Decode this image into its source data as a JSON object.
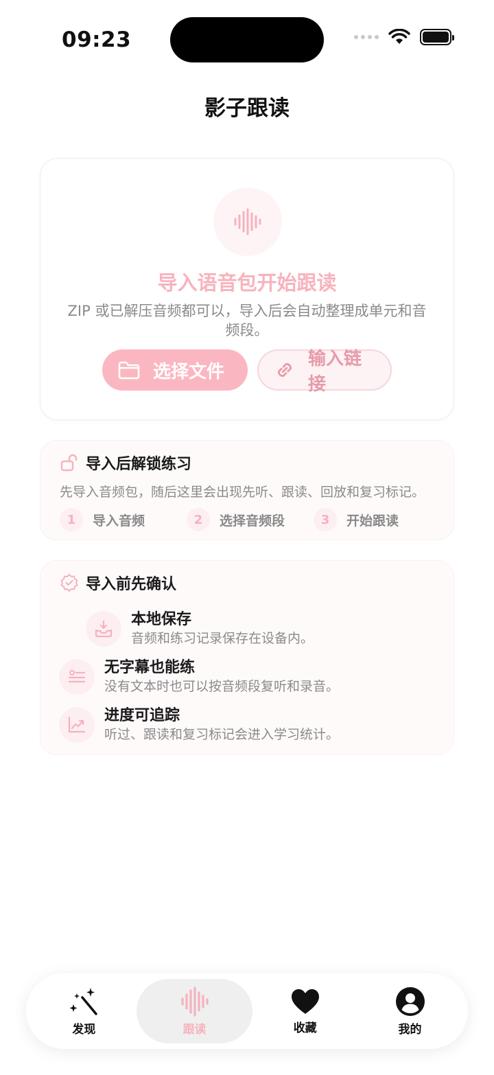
{
  "status": {
    "time": "09:23"
  },
  "page": {
    "title": "影子跟读"
  },
  "import_card": {
    "title": "导入语音包开始跟读",
    "description": "ZIP 或已解压音频都可以，导入后会自动整理成单元和音频段。",
    "primary_button": "选择文件",
    "secondary_button": "输入链接"
  },
  "unlock_card": {
    "title": "导入后解锁练习",
    "description": "先导入音频包，随后这里会出现先听、跟读、回放和复习标记。",
    "steps": [
      {
        "num": "1",
        "label": "导入音频"
      },
      {
        "num": "2",
        "label": "选择音频段"
      },
      {
        "num": "3",
        "label": "开始跟读"
      }
    ]
  },
  "confirm_card": {
    "title": "导入前先确认",
    "features": [
      {
        "title": "本地保存",
        "sub": "音频和练习记录保存在设备内。",
        "icon": "tray-download-icon"
      },
      {
        "title": "无字幕也能练",
        "sub": "没有文本时也可以按音频段复听和录音。",
        "icon": "list-icon"
      },
      {
        "title": "进度可追踪",
        "sub": "听过、跟读和复习标记会进入学习统计。",
        "icon": "chart-trend-icon"
      }
    ]
  },
  "tabs": [
    {
      "label": "发现",
      "icon": "magic-wand-icon",
      "active": false
    },
    {
      "label": "跟读",
      "icon": "waveform-icon",
      "active": true
    },
    {
      "label": "收藏",
      "icon": "heart-icon",
      "active": false
    },
    {
      "label": "我的",
      "icon": "person-circle-icon",
      "active": false
    }
  ],
  "colors": {
    "accent": "#fbb7c1",
    "accent_text": "#f7b3bd",
    "secondary_text": "#8a8a8a",
    "card_tint": "#fffafa"
  }
}
